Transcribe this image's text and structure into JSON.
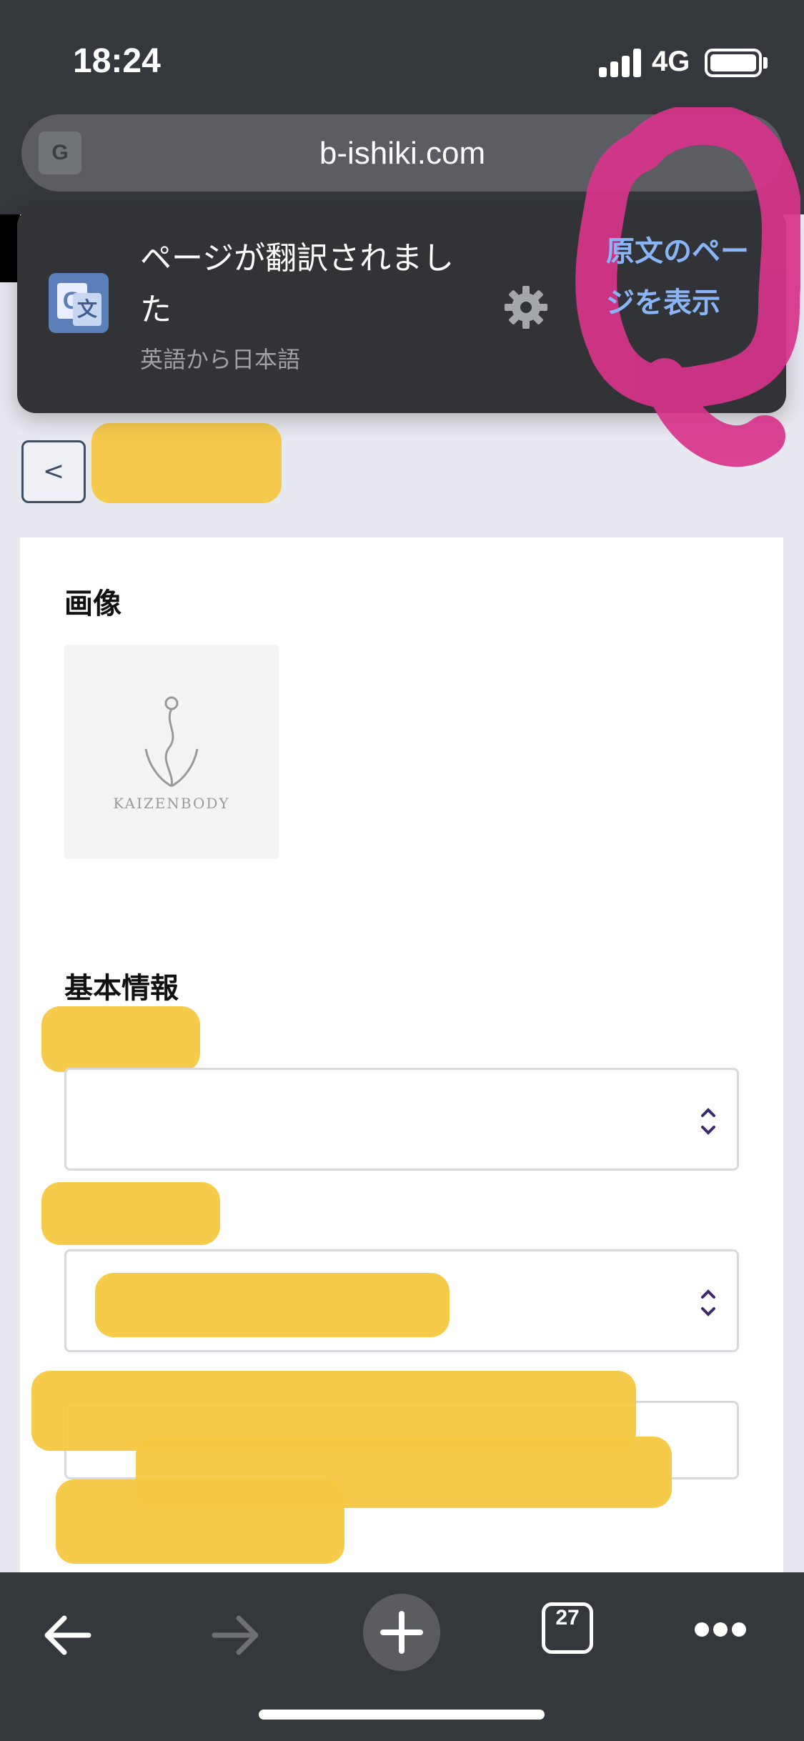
{
  "status_bar": {
    "time": "18:24",
    "network": "4G"
  },
  "browser": {
    "url": "b-ishiki.com",
    "translate_icon": "google-translate-icon"
  },
  "translation_popup": {
    "title": "ページが翻訳されました",
    "subtitle": "英語から日本語",
    "action": "原文のページを表示",
    "settings_icon": "gear-icon"
  },
  "page": {
    "back_symbol": "<",
    "image_section_title": "画像",
    "image_logo_text": "KAIZENBODY",
    "basic_info_title": "基本情報"
  },
  "toolbar": {
    "tab_count": "27",
    "icons": [
      "back-arrow-icon",
      "forward-arrow-icon",
      "plus-icon",
      "tabs-icon",
      "more-icon"
    ]
  },
  "colors": {
    "chrome": "#34373b",
    "link_blue": "#8ab4f8",
    "redaction": "#f5c842",
    "annotation_pink": "#d8348a"
  }
}
